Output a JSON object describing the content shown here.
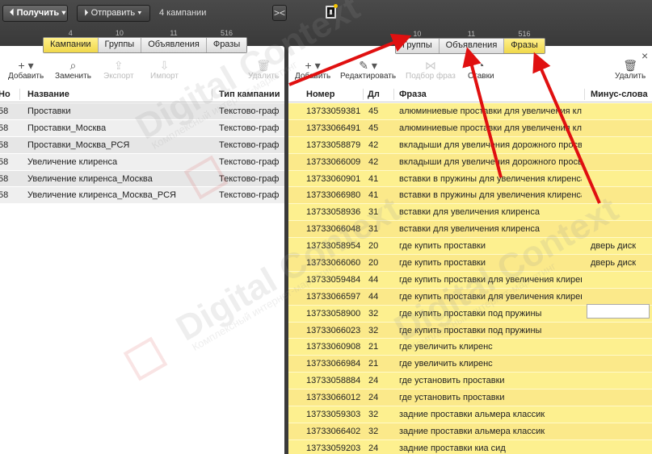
{
  "topbar": {
    "get_label": "Получить",
    "send_label": "Отправить",
    "campaigns_count": "4 кампании",
    "collapse_label": "><"
  },
  "left": {
    "tabs": [
      {
        "label": "Кампании",
        "count": "4"
      },
      {
        "label": "Группы",
        "count": "10"
      },
      {
        "label": "Объявления",
        "count": "11"
      },
      {
        "label": "Фразы",
        "count": "516"
      }
    ],
    "toolbar": {
      "add": "Добавить",
      "replace": "Заменить",
      "export": "Экспорт",
      "import": "Импорт",
      "delete": "Удалить"
    },
    "columns": {
      "num": "Но",
      "name": "Название",
      "type": "Тип кампании"
    },
    "rows": [
      {
        "num": "58",
        "name": "Проставки",
        "type": "Текстово-граф"
      },
      {
        "num": "58",
        "name": "Проставки_Москва",
        "type": "Текстово-граф"
      },
      {
        "num": "58",
        "name": "Проставки_Москва_РСЯ",
        "type": "Текстово-граф"
      },
      {
        "num": "58",
        "name": "Увеличение клиренса",
        "type": "Текстово-граф"
      },
      {
        "num": "58",
        "name": "Увеличение клиренса_Москва",
        "type": "Текстово-граф"
      },
      {
        "num": "58",
        "name": "Увеличение клиренса_Москва_РСЯ",
        "type": "Текстово-граф"
      }
    ]
  },
  "right": {
    "tabs": [
      {
        "label": "Группы",
        "count": "10"
      },
      {
        "label": "Объявления",
        "count": "11"
      },
      {
        "label": "Фразы",
        "count": "516"
      }
    ],
    "toolbar": {
      "add": "Добавить",
      "edit": "Редактировать",
      "phrase_pick": "Подбор фраз",
      "rates": "Ставки",
      "delete": "Удалить"
    },
    "columns": {
      "num": "Номер",
      "len": "Дл",
      "phrase": "Фраза",
      "minus": "Минус-слова"
    },
    "rows": [
      {
        "num": "13733059381",
        "len": "45",
        "phrase": "алюминиевые проставки для увеличения клир",
        "minus": ""
      },
      {
        "num": "13733066491",
        "len": "45",
        "phrase": "алюминиевые проставки для увеличения клир",
        "minus": ""
      },
      {
        "num": "13733058879",
        "len": "42",
        "phrase": "вкладыши для увеличения дорожного просвета",
        "minus": ""
      },
      {
        "num": "13733066009",
        "len": "42",
        "phrase": "вкладыши для увеличения дорожного просвета",
        "minus": ""
      },
      {
        "num": "13733060901",
        "len": "41",
        "phrase": "вставки в пружины для увеличения клиренса",
        "minus": ""
      },
      {
        "num": "13733066980",
        "len": "41",
        "phrase": "вставки в пружины для увеличения клиренса",
        "minus": ""
      },
      {
        "num": "13733058936",
        "len": "31",
        "phrase": "вставки для увеличения клиренса",
        "minus": ""
      },
      {
        "num": "13733066048",
        "len": "31",
        "phrase": "вставки для увеличения клиренса",
        "minus": ""
      },
      {
        "num": "13733058954",
        "len": "20",
        "phrase": "где купить проставки",
        "minus": "дверь диск"
      },
      {
        "num": "13733066060",
        "len": "20",
        "phrase": "где купить проставки",
        "minus": "дверь диск"
      },
      {
        "num": "13733059484",
        "len": "44",
        "phrase": "где купить проставки для увеличения клиренса",
        "minus": ""
      },
      {
        "num": "13733066597",
        "len": "44",
        "phrase": "где купить проставки для увеличения клиренса",
        "minus": ""
      },
      {
        "num": "13733058900",
        "len": "32",
        "phrase": "где купить проставки под пружины",
        "minus": ""
      },
      {
        "num": "13733066023",
        "len": "32",
        "phrase": "где купить проставки под пружины",
        "minus": ""
      },
      {
        "num": "13733060908",
        "len": "21",
        "phrase": "где увеличить клиренс",
        "minus": ""
      },
      {
        "num": "13733066984",
        "len": "21",
        "phrase": "где увеличить клиренс",
        "minus": ""
      },
      {
        "num": "13733058884",
        "len": "24",
        "phrase": "где установить проставки",
        "minus": ""
      },
      {
        "num": "13733066012",
        "len": "24",
        "phrase": "где установить проставки",
        "minus": ""
      },
      {
        "num": "13733059303",
        "len": "32",
        "phrase": "задние проставки альмера классик",
        "minus": ""
      },
      {
        "num": "13733066402",
        "len": "32",
        "phrase": "задние проставки альмера классик",
        "minus": ""
      },
      {
        "num": "13733059203",
        "len": "24",
        "phrase": "задние проставки киа сид",
        "minus": ""
      }
    ]
  },
  "watermark": {
    "brand": "Digital Context",
    "tagline": "Комплексный интернет-маркетинг"
  },
  "colors": {
    "highlight": "#fdf08f",
    "active_tab": "#f0d84a",
    "arrow": "#e01010"
  }
}
